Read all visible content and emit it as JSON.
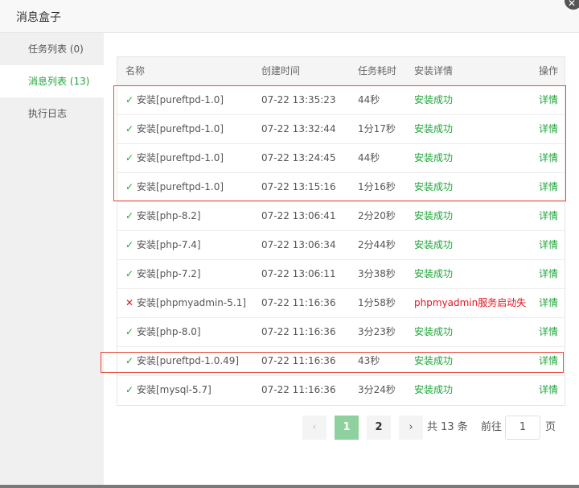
{
  "dialog": {
    "title": "消息盒子",
    "close": "✕"
  },
  "sidebar": {
    "items": [
      {
        "label": "任务列表 (0)"
      },
      {
        "label": "消息列表 (13)"
      },
      {
        "label": "执行日志"
      }
    ]
  },
  "table": {
    "headers": {
      "name": "名称",
      "time": "创建时间",
      "cost": "任务耗时",
      "detail": "安装详情",
      "op": "操作"
    },
    "rows": [
      {
        "status": "ok",
        "mark": "✓",
        "name": "安装[pureftpd-1.0]",
        "time": "07-22 13:35:23",
        "cost": "44秒",
        "detail": "安装成功",
        "op": "详情"
      },
      {
        "status": "ok",
        "mark": "✓",
        "name": "安装[pureftpd-1.0]",
        "time": "07-22 13:32:44",
        "cost": "1分17秒",
        "detail": "安装成功",
        "op": "详情"
      },
      {
        "status": "ok",
        "mark": "✓",
        "name": "安装[pureftpd-1.0]",
        "time": "07-22 13:24:45",
        "cost": "44秒",
        "detail": "安装成功",
        "op": "详情"
      },
      {
        "status": "ok",
        "mark": "✓",
        "name": "安装[pureftpd-1.0]",
        "time": "07-22 13:15:16",
        "cost": "1分16秒",
        "detail": "安装成功",
        "op": "详情"
      },
      {
        "status": "ok",
        "mark": "✓",
        "name": "安装[php-8.2]",
        "time": "07-22 13:06:41",
        "cost": "2分20秒",
        "detail": "安装成功",
        "op": "详情"
      },
      {
        "status": "ok",
        "mark": "✓",
        "name": "安装[php-7.4]",
        "time": "07-22 13:06:34",
        "cost": "2分44秒",
        "detail": "安装成功",
        "op": "详情"
      },
      {
        "status": "ok",
        "mark": "✓",
        "name": "安装[php-7.2]",
        "time": "07-22 13:06:11",
        "cost": "3分38秒",
        "detail": "安装成功",
        "op": "详情"
      },
      {
        "status": "fail",
        "mark": "✕",
        "name": "安装[phpmyadmin-5.1]",
        "time": "07-22 11:16:36",
        "cost": "1分58秒",
        "detail": "phpmyadmin服务启动失",
        "op": "详情"
      },
      {
        "status": "ok",
        "mark": "✓",
        "name": "安装[php-8.0]",
        "time": "07-22 11:16:36",
        "cost": "3分23秒",
        "detail": "安装成功",
        "op": "详情"
      },
      {
        "status": "ok",
        "mark": "✓",
        "name": "安装[pureftpd-1.0.49]",
        "time": "07-22 11:16:36",
        "cost": "43秒",
        "detail": "安装成功",
        "op": "详情"
      },
      {
        "status": "ok",
        "mark": "✓",
        "name": "安装[mysql-5.7]",
        "time": "07-22 11:16:36",
        "cost": "3分24秒",
        "detail": "安装成功",
        "op": "详情"
      }
    ]
  },
  "pagination": {
    "prev": "‹",
    "page1": "1",
    "page2": "2",
    "next": "›",
    "total": "共 13 条",
    "goto": "前往",
    "page_input": "1",
    "page_suffix": "页"
  },
  "colors": {
    "accent": "#20a53a",
    "error": "#e6131f",
    "highlight": "#e74c3c"
  }
}
